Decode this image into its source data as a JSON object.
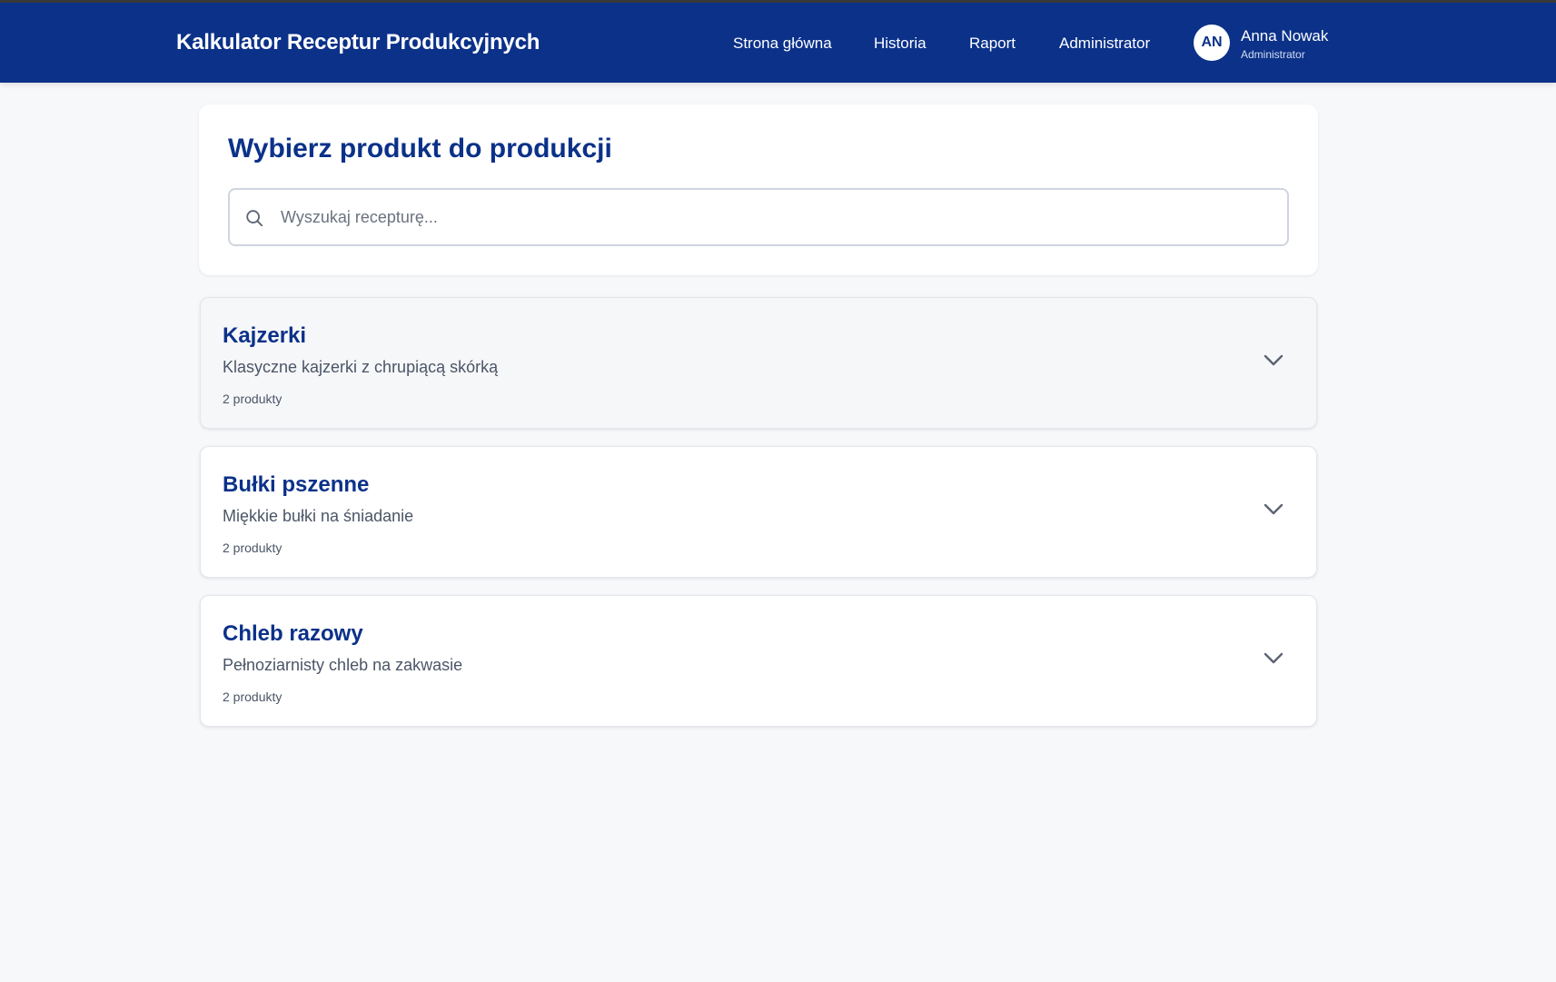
{
  "header": {
    "app_title": "Kalkulator Receptur Produkcyjnych",
    "nav": [
      {
        "label": "Strona główna"
      },
      {
        "label": "Historia"
      },
      {
        "label": "Raport"
      },
      {
        "label": "Administrator"
      }
    ],
    "user": {
      "initials": "AN",
      "name": "Anna Nowak",
      "role": "Administrator"
    }
  },
  "main": {
    "title": "Wybierz produkt do produkcji",
    "search": {
      "placeholder": "Wyszukaj recepturę...",
      "value": ""
    },
    "categories": [
      {
        "name": "Kajzerki",
        "description": "Klasyczne kajzerki z chrupiącą skórką",
        "count": "2 produkty"
      },
      {
        "name": "Bułki pszenne",
        "description": "Miękkie bułki na śniadanie",
        "count": "2 produkty"
      },
      {
        "name": "Chleb razowy",
        "description": "Pełnoziarnisty chleb na zakwasie",
        "count": "2 produkty"
      }
    ]
  },
  "colors": {
    "brand": "#0b3189",
    "background": "#f7f8fa",
    "muted_text": "#4b5567"
  },
  "icons": {
    "search": "search-icon",
    "expand": "chevron-down-icon"
  }
}
